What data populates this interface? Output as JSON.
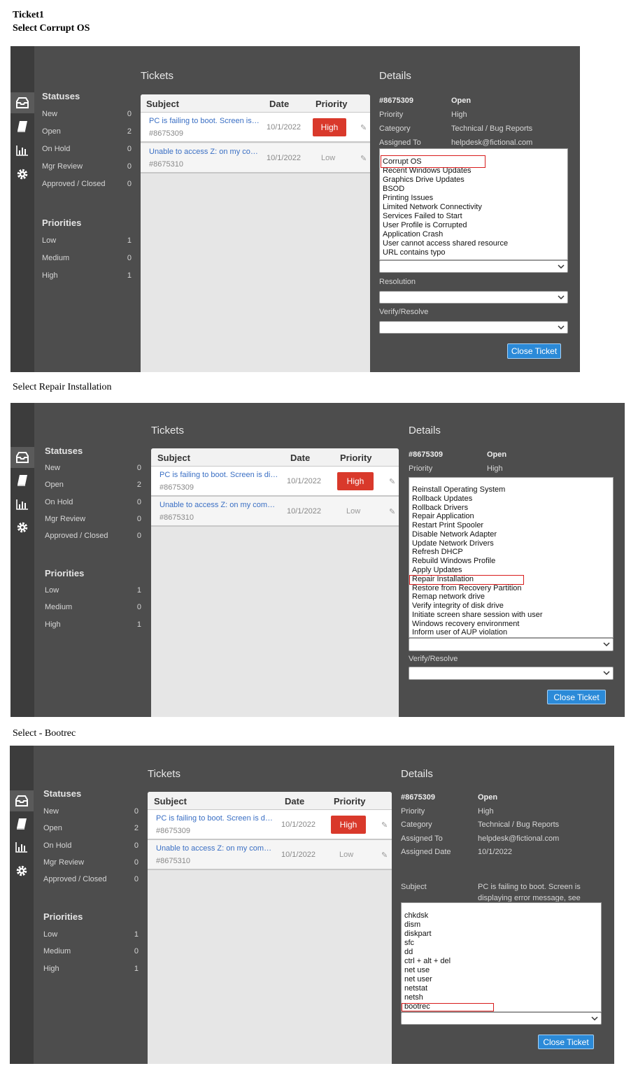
{
  "captions": {
    "ticket": "Ticket1",
    "step1": "Select Corrupt OS",
    "step2": "Select Repair Installation",
    "step3": "Select - Bootrec"
  },
  "common": {
    "tickets_title": "Tickets",
    "details_title": "Details",
    "statuses_title": "Statuses",
    "priorities_title": "Priorities",
    "statuses": [
      {
        "label": "New",
        "count": "0"
      },
      {
        "label": "Open",
        "count": "2"
      },
      {
        "label": "On Hold",
        "count": "0"
      },
      {
        "label": "Mgr Review",
        "count": "0"
      },
      {
        "label": "Approved / Closed",
        "count": "0"
      }
    ],
    "priorities": [
      {
        "label": "Low",
        "count": "1"
      },
      {
        "label": "Medium",
        "count": "0"
      },
      {
        "label": "High",
        "count": "1"
      }
    ],
    "columns": {
      "subject": "Subject",
      "date": "Date",
      "priority": "Priority"
    },
    "tickets": [
      {
        "subject": "PC is failing to boot. Screen is displaying error message",
        "id": "#8675309",
        "date": "10/1/2022",
        "priority": "High"
      },
      {
        "subject": "Unable to access Z: on my computer",
        "id": "#8675310",
        "date": "10/1/2022",
        "priority": "Low"
      }
    ],
    "close_button": "Close Ticket",
    "colors": {
      "panel": "#4d4d4d",
      "rail": "#3c3c3c",
      "high": "#d9392b",
      "button": "#2b8ad8",
      "highlight": "#d81c1c",
      "link": "#3a6fc4"
    }
  },
  "panel1": {
    "ticket_id": "#8675309",
    "status": "Open",
    "fields": [
      {
        "label": "Priority",
        "value": "High"
      },
      {
        "label": "Category",
        "value": "Technical / Bug Reports"
      },
      {
        "label": "Assigned To",
        "value": "helpdesk@fictional.com"
      }
    ],
    "issue_options": [
      "Corrupt OS",
      "Recent Windows Updates",
      "Graphics Drive Updates",
      "BSOD",
      "Printing Issues",
      "Limited Network Connectivity",
      "Services Failed to Start",
      "User Profile is Corrupted",
      "Application Crash",
      "User cannot access shared resource",
      "URL contains typo"
    ],
    "selected_issue": "Corrupt OS",
    "resolution_label": "Resolution",
    "verify_label": "Verify/Resolve"
  },
  "panel2": {
    "ticket_id": "#8675309",
    "status": "Open",
    "fields": [
      {
        "label": "Priority",
        "value": "High"
      }
    ],
    "resolution_options": [
      "Reinstall Operating System",
      "Rollback Updates",
      "Rollback Drivers",
      "Repair Application",
      "Restart Print Spooler",
      "Disable Network Adapter",
      "Update Network Drivers",
      "Refresh DHCP",
      "Rebuild Windows Profile",
      "Apply Updates",
      "Repair Installation",
      "Restore from Recovery Partition",
      "Remap network drive",
      "Verify integrity of disk drive",
      "Initiate screen share session with user",
      "Windows recovery environment",
      "Inform user of AUP violation"
    ],
    "selected_resolution": "Repair Installation",
    "verify_label": "Verify/Resolve"
  },
  "panel3": {
    "ticket_id": "#8675309",
    "status": "Open",
    "fields": [
      {
        "label": "Priority",
        "value": "High"
      },
      {
        "label": "Category",
        "value": "Technical / Bug Reports"
      },
      {
        "label": "Assigned To",
        "value": "helpdesk@fictional.com"
      },
      {
        "label": "Assigned Date",
        "value": "10/1/2022"
      }
    ],
    "subject_label": "Subject",
    "subject_line1": "PC is failing to boot. Screen is",
    "subject_line2": "displaying error message, see",
    "verify_options": [
      "chkdsk",
      "dism",
      "diskpart",
      "sfc",
      "dd",
      "ctrl + alt + del",
      "net use",
      "net user",
      "netstat",
      "netsh",
      "bootrec"
    ],
    "selected_verify": "bootrec"
  }
}
